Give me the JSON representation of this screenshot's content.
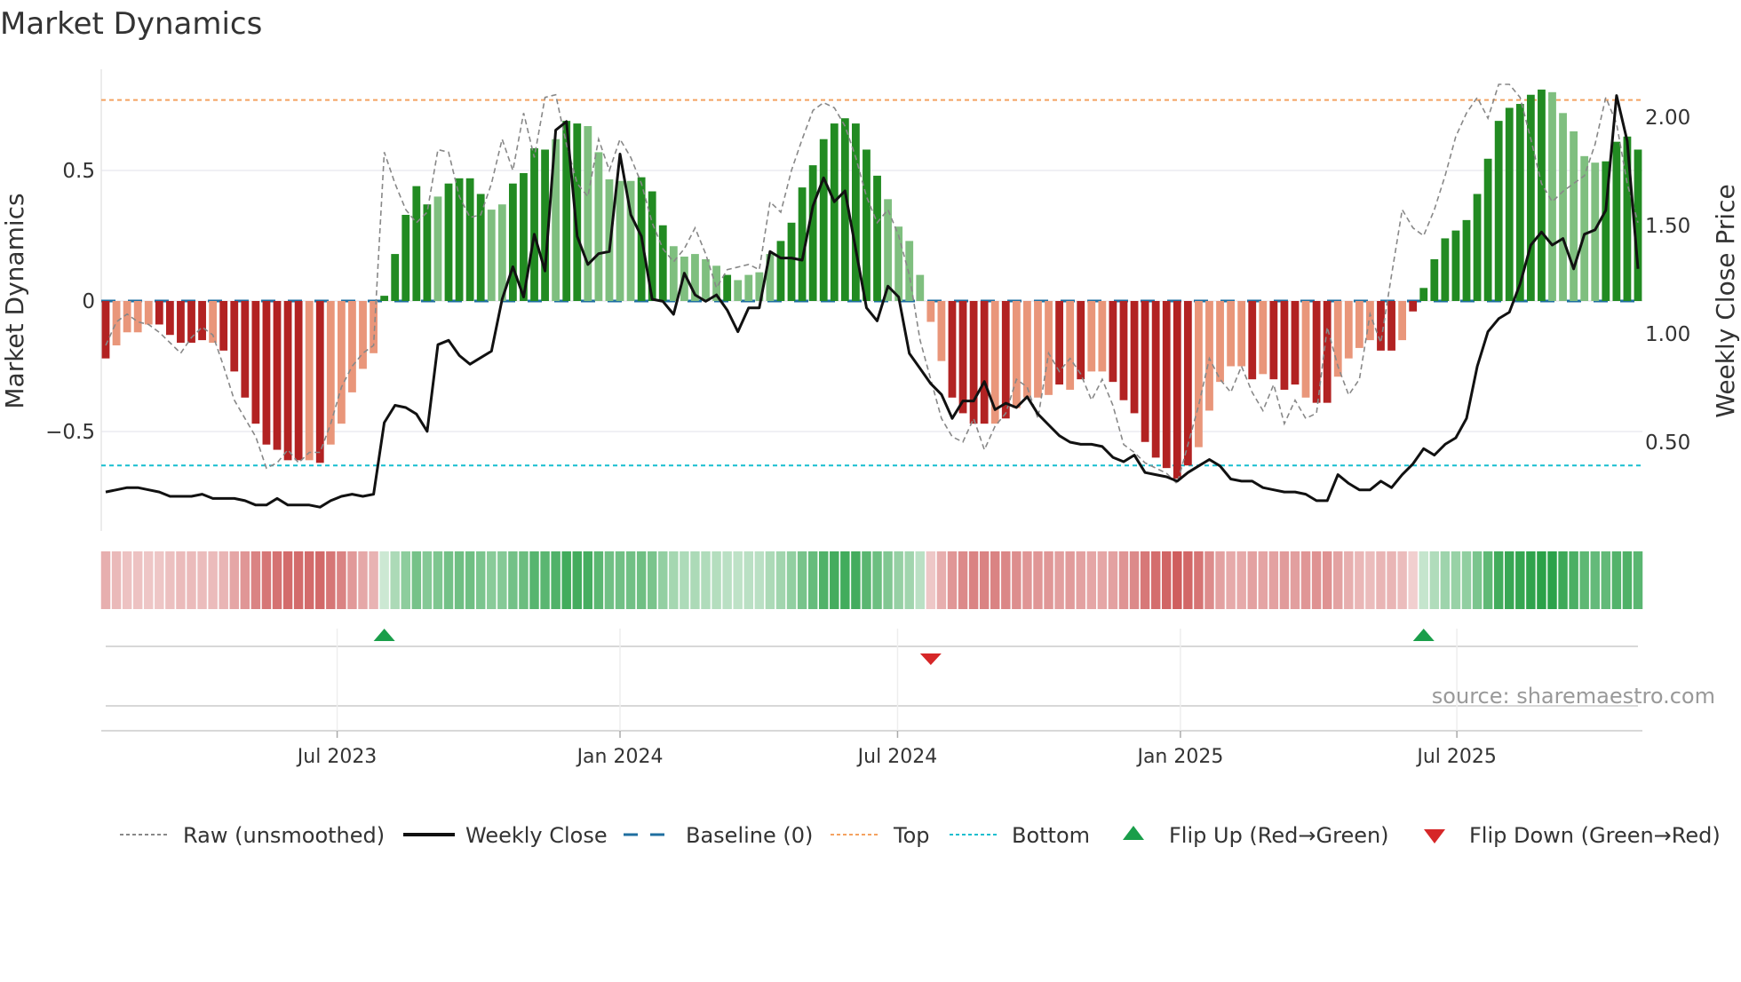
{
  "chart_data": {
    "type": "bar",
    "title": "Market Dynamics",
    "ylabel": "Market Dynamics",
    "y2label": "Weekly Close Price",
    "ylim": [
      -0.85,
      0.93
    ],
    "y2lim": [
      0.05,
      2.28
    ],
    "yticks": [
      {
        "v": 0.5,
        "label": "0.5"
      },
      {
        "v": 0,
        "label": "0"
      },
      {
        "v": -0.5,
        "label": "−0.5"
      }
    ],
    "y2ticks": [
      {
        "v": 2.0,
        "label": "2.00"
      },
      {
        "v": 1.5,
        "label": "1.50"
      },
      {
        "v": 1.0,
        "label": "1.00"
      },
      {
        "v": 0.5,
        "label": "0.50"
      }
    ],
    "xticks": [
      {
        "week": 21.6,
        "label": "Jul 2023"
      },
      {
        "week": 48.0,
        "label": "Jan 2024"
      },
      {
        "week": 73.9,
        "label": "Jul 2024"
      },
      {
        "week": 100.3,
        "label": "Jan 2025"
      },
      {
        "week": 126.1,
        "label": "Jul 2025"
      }
    ],
    "top_level": 0.77,
    "bottom_level": -0.63,
    "baseline": 0,
    "momentum": [
      -0.22,
      -0.17,
      -0.12,
      -0.12,
      -0.09,
      -0.09,
      -0.13,
      -0.16,
      -0.16,
      -0.15,
      -0.16,
      -0.19,
      -0.27,
      -0.37,
      -0.47,
      -0.55,
      -0.57,
      -0.61,
      -0.61,
      -0.61,
      -0.62,
      -0.55,
      -0.47,
      -0.35,
      -0.26,
      -0.2,
      0.02,
      0.18,
      0.33,
      0.44,
      0.37,
      0.4,
      0.45,
      0.47,
      0.47,
      0.41,
      0.35,
      0.37,
      0.45,
      0.49,
      0.585,
      0.58,
      0.62,
      0.69,
      0.68,
      0.67,
      0.57,
      0.466,
      0.46,
      0.46,
      0.474,
      0.42,
      0.29,
      0.21,
      0.17,
      0.18,
      0.16,
      0.135,
      0.1,
      0.08,
      0.1,
      0.11,
      0.18,
      0.23,
      0.3,
      0.435,
      0.52,
      0.62,
      0.68,
      0.7,
      0.68,
      0.58,
      0.48,
      0.39,
      0.285,
      0.23,
      0.1,
      -0.08,
      -0.23,
      -0.37,
      -0.43,
      -0.47,
      -0.47,
      -0.47,
      -0.45,
      -0.41,
      -0.37,
      -0.37,
      -0.36,
      -0.32,
      -0.34,
      -0.3,
      -0.27,
      -0.27,
      -0.31,
      -0.38,
      -0.43,
      -0.54,
      -0.6,
      -0.64,
      -0.68,
      -0.63,
      -0.56,
      -0.42,
      -0.31,
      -0.25,
      -0.25,
      -0.3,
      -0.28,
      -0.3,
      -0.34,
      -0.32,
      -0.37,
      -0.39,
      -0.39,
      -0.29,
      -0.22,
      -0.18,
      -0.15,
      -0.19,
      -0.19,
      -0.15,
      -0.04,
      0.05,
      0.16,
      0.24,
      0.27,
      0.31,
      0.41,
      0.545,
      0.69,
      0.74,
      0.755,
      0.79,
      0.81,
      0.8,
      0.72,
      0.65,
      0.555,
      0.53,
      0.535,
      0.61,
      0.63,
      0.58
    ],
    "shade": "dlllldddddlddddddddldllllldddddlddddllddddlddllllldddllllldllllddddddddddllllllddddldlllldldllddddddddllllldldddlddllllddldddddddddddddlllllddddl",
    "raw": [
      -0.17,
      -0.08,
      -0.05,
      -0.08,
      -0.09,
      -0.12,
      -0.16,
      -0.2,
      -0.14,
      -0.1,
      -0.13,
      -0.25,
      -0.38,
      -0.45,
      -0.52,
      -0.64,
      -0.62,
      -0.57,
      -0.62,
      -0.58,
      -0.58,
      -0.47,
      -0.33,
      -0.25,
      -0.2,
      -0.17,
      0.57,
      0.45,
      0.35,
      0.3,
      0.34,
      0.58,
      0.57,
      0.4,
      0.32,
      0.33,
      0.45,
      0.62,
      0.5,
      0.72,
      0.55,
      0.78,
      0.79,
      0.6,
      0.45,
      0.4,
      0.62,
      0.5,
      0.62,
      0.55,
      0.45,
      0.3,
      0.2,
      0.15,
      0.2,
      0.28,
      0.18,
      0.05,
      0.12,
      0.13,
      0.14,
      0.12,
      0.38,
      0.34,
      0.5,
      0.62,
      0.73,
      0.76,
      0.74,
      0.67,
      0.55,
      0.4,
      0.3,
      0.35,
      0.25,
      0.1,
      -0.15,
      -0.3,
      -0.45,
      -0.52,
      -0.54,
      -0.45,
      -0.57,
      -0.48,
      -0.43,
      -0.3,
      -0.33,
      -0.45,
      -0.2,
      -0.27,
      -0.22,
      -0.28,
      -0.38,
      -0.3,
      -0.4,
      -0.55,
      -0.58,
      -0.62,
      -0.64,
      -0.66,
      -0.7,
      -0.55,
      -0.4,
      -0.22,
      -0.3,
      -0.35,
      -0.25,
      -0.35,
      -0.42,
      -0.32,
      -0.47,
      -0.38,
      -0.45,
      -0.43,
      -0.1,
      -0.25,
      -0.36,
      -0.3,
      -0.05,
      -0.16,
      0.1,
      0.35,
      0.28,
      0.25,
      0.35,
      0.48,
      0.63,
      0.72,
      0.78,
      0.7,
      0.83,
      0.83,
      0.78,
      0.62,
      0.45,
      0.38,
      0.42,
      0.45,
      0.48,
      0.6,
      0.78,
      0.68,
      0.45,
      0.3
    ],
    "close": [
      0.27,
      0.28,
      0.29,
      0.29,
      0.28,
      0.27,
      0.25,
      0.25,
      0.25,
      0.26,
      0.24,
      0.24,
      0.24,
      0.23,
      0.21,
      0.21,
      0.24,
      0.21,
      0.21,
      0.21,
      0.2,
      0.23,
      0.25,
      0.26,
      0.25,
      0.26,
      0.59,
      0.67,
      0.66,
      0.63,
      0.55,
      0.95,
      0.97,
      0.9,
      0.86,
      0.89,
      0.92,
      1.16,
      1.31,
      1.17,
      1.46,
      1.29,
      1.94,
      1.98,
      1.45,
      1.32,
      1.37,
      1.38,
      1.83,
      1.55,
      1.45,
      1.16,
      1.15,
      1.09,
      1.28,
      1.18,
      1.15,
      1.18,
      1.11,
      1.01,
      1.12,
      1.12,
      1.38,
      1.35,
      1.35,
      1.34,
      1.59,
      1.72,
      1.61,
      1.66,
      1.39,
      1.12,
      1.06,
      1.22,
      1.17,
      0.91,
      0.84,
      0.77,
      0.72,
      0.61,
      0.69,
      0.69,
      0.78,
      0.65,
      0.68,
      0.66,
      0.71,
      0.63,
      0.58,
      0.53,
      0.5,
      0.49,
      0.49,
      0.48,
      0.43,
      0.41,
      0.44,
      0.36,
      0.35,
      0.34,
      0.32,
      0.36,
      0.39,
      0.42,
      0.39,
      0.33,
      0.32,
      0.32,
      0.29,
      0.28,
      0.27,
      0.27,
      0.26,
      0.23,
      0.23,
      0.35,
      0.31,
      0.28,
      0.28,
      0.32,
      0.29,
      0.35,
      0.4,
      0.47,
      0.44,
      0.49,
      0.52,
      0.61,
      0.85,
      1.01,
      1.07,
      1.1,
      1.23,
      1.41,
      1.47,
      1.41,
      1.44,
      1.3,
      1.46,
      1.48,
      1.57,
      2.1,
      1.89,
      1.3
    ],
    "flips": [
      {
        "week": 26,
        "dir": "up"
      },
      {
        "week": 77,
        "dir": "down"
      },
      {
        "week": 123,
        "dir": "up"
      }
    ],
    "legend": {
      "raw": "Raw (unsmoothed)",
      "close": "Weekly Close",
      "baseline": "Baseline (0)",
      "top": "Top",
      "bottom": "Bottom",
      "flip_up": "Flip Up (Red→Green)",
      "flip_down": "Flip Down (Green→Red)",
      "placement": "bottom"
    },
    "source": "source: sharemaestro.com",
    "colors": {
      "green_dark": "#228b22",
      "green_light": "#7fbf7f",
      "red_dark": "#b22222",
      "red_light": "#e9967a",
      "baseline": "#1f6fa0",
      "top": "#f4a261",
      "bottom": "#17becf",
      "raw": "#888888",
      "close": "#111111",
      "flip_up": "#1a9e4a",
      "flip_down": "#d62728"
    }
  }
}
